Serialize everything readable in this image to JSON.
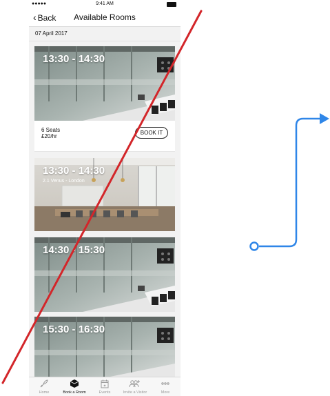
{
  "status_bar": {
    "signal": "●●●●● ",
    "time": "9:41 AM"
  },
  "nav": {
    "back_label": "Back",
    "title": "Available Rooms"
  },
  "date_header": "07 April 2017",
  "rooms": [
    {
      "time": "13:30 - 14:30",
      "location": "",
      "seats": "6 Seats",
      "price": "£20/hr",
      "button": "BOOK IT",
      "expanded": true,
      "scene": "glass"
    },
    {
      "time": "13:30 - 14:30",
      "location": "2.1 Venus - London",
      "scene": "bright"
    },
    {
      "time": "14:30 - 15:30",
      "location": "",
      "scene": "glass"
    },
    {
      "time": "15:30 - 16:30",
      "location": "",
      "scene": "glass"
    }
  ],
  "tab_bar": {
    "items": [
      {
        "label": "Home",
        "icon": "rocket-icon",
        "active": false
      },
      {
        "label": "Book a Room",
        "icon": "cube-icon",
        "active": true
      },
      {
        "label": "Events",
        "icon": "calendar-star-icon",
        "active": false
      },
      {
        "label": "Invite a Visitor",
        "icon": "add-people-icon",
        "active": false
      },
      {
        "label": "More",
        "icon": "more-dots-icon",
        "active": false
      }
    ]
  },
  "annotation": {
    "strike_color": "#d3262a",
    "flow_arrow_color": "#2f86e8"
  }
}
